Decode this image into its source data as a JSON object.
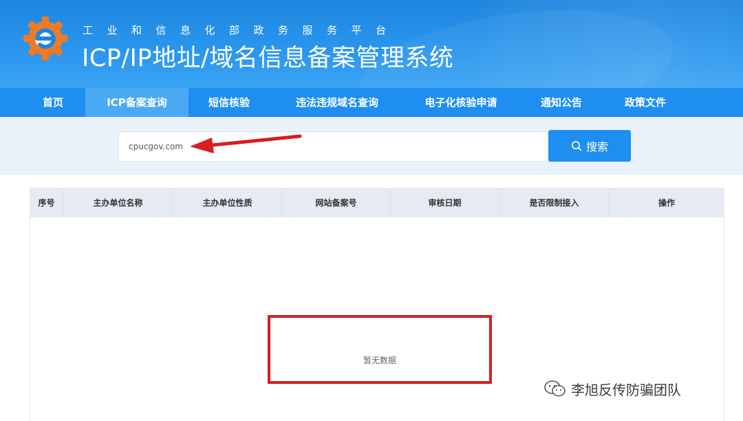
{
  "header": {
    "subtitle": "工业和信息化部政务服务平台",
    "title": "ICP/IP地址/域名信息备案管理系统",
    "brand_color": "#1f86de"
  },
  "nav": {
    "items": [
      {
        "label": "首页",
        "active": false
      },
      {
        "label": "ICP备案查询",
        "active": true
      },
      {
        "label": "短信核验",
        "active": false
      },
      {
        "label": "违法违规域名查询",
        "active": false
      },
      {
        "label": "电子化核验申请",
        "active": false
      },
      {
        "label": "通知公告",
        "active": false
      },
      {
        "label": "政策文件",
        "active": false
      }
    ]
  },
  "search": {
    "value": "cpucgov.com",
    "button_label": "搜索",
    "button_icon": "search-icon"
  },
  "table": {
    "columns": [
      "序号",
      "主办单位名称",
      "主办单位性质",
      "网站备案号",
      "审核日期",
      "是否限制接入",
      "操作"
    ],
    "empty_text": "暂无数据"
  },
  "annotations": {
    "highlight_color": "#d81e1e"
  },
  "watermark": {
    "text": "李旭反传防骗团队",
    "icon": "wechat-icon"
  }
}
